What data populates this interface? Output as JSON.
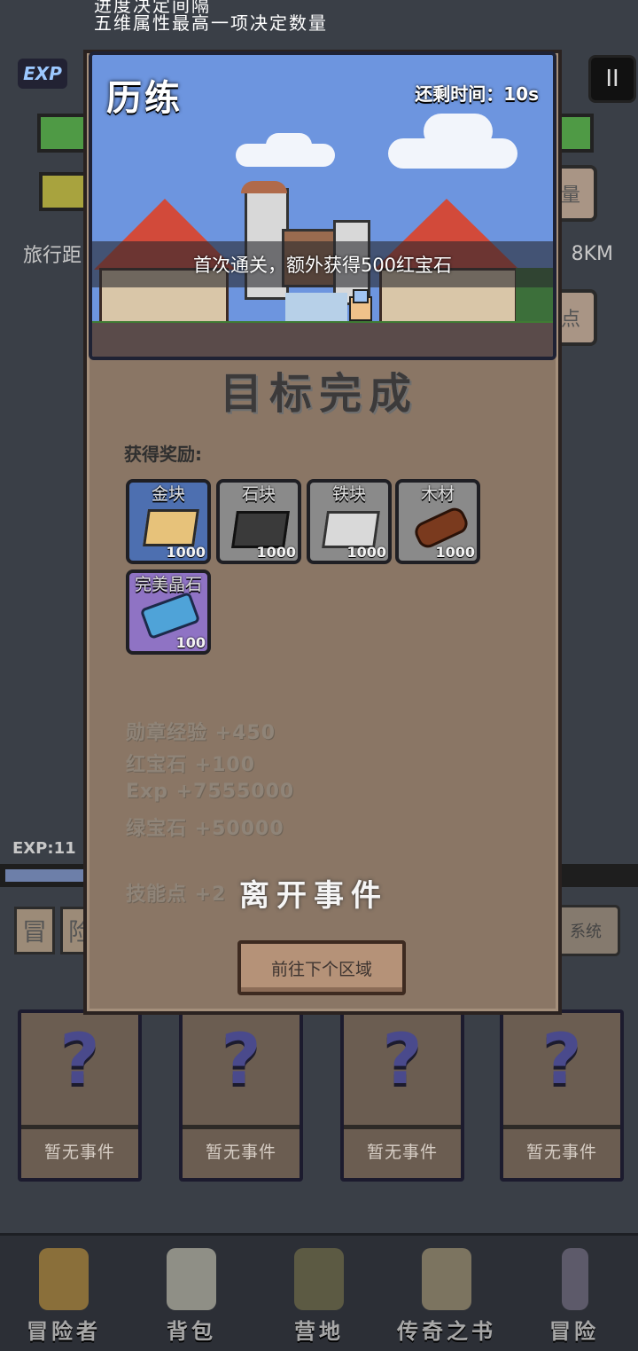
{
  "background": {
    "top_text_1": "进度决定间隔",
    "top_text_2": "五维属性最高一项决定数量",
    "exp_badge": "EXP",
    "pause_icon": "II",
    "distance_label": "旅行距",
    "distance_value": "8KM",
    "side_btn_1": "量",
    "side_btn_2": "点",
    "exp_text": "EXP:11",
    "tab_1": "冒",
    "tab_2": "险",
    "system_btn": "系统"
  },
  "events": [
    {
      "icon": "?",
      "label": "暂无事件"
    },
    {
      "icon": "?",
      "label": "暂无事件"
    },
    {
      "icon": "?",
      "label": "暂无事件"
    },
    {
      "icon": "?",
      "label": "暂无事件"
    }
  ],
  "nav": [
    {
      "label": "冒险者",
      "icon": "crown-icon"
    },
    {
      "label": "背包",
      "icon": "backpack-icon"
    },
    {
      "label": "营地",
      "icon": "camp-icon"
    },
    {
      "label": "传奇之书",
      "icon": "book-icon"
    },
    {
      "label": "冒险",
      "icon": "sword-icon"
    }
  ],
  "modal": {
    "scene_title": "历练",
    "timer": "还剩时间：10s",
    "banner": "首次通关，额外获得500红宝石",
    "goal_title": "目标完成",
    "rewards_label": "获得奖励:",
    "items": [
      {
        "name": "金块",
        "count": "1000",
        "bg": "#4d6fb0",
        "icon": "gold-block-icon"
      },
      {
        "name": "石块",
        "count": "1000",
        "bg": "#8a8a8a",
        "icon": "stone-block-icon"
      },
      {
        "name": "铁块",
        "count": "1000",
        "bg": "#8a8a8a",
        "icon": "iron-block-icon"
      },
      {
        "name": "木材",
        "count": "1000",
        "bg": "#8a8a8a",
        "icon": "wood-icon"
      },
      {
        "name": "完美晶石",
        "count": "100",
        "bg": "#8f73c4",
        "icon": "crystal-icon"
      }
    ],
    "stats": [
      "勋章经验 +450",
      "红宝石 +100",
      "Exp +7555000",
      "绿宝石 +50000",
      "技能点 +2"
    ],
    "leave_label": "离开事件",
    "next_button": "前往下个区域"
  }
}
